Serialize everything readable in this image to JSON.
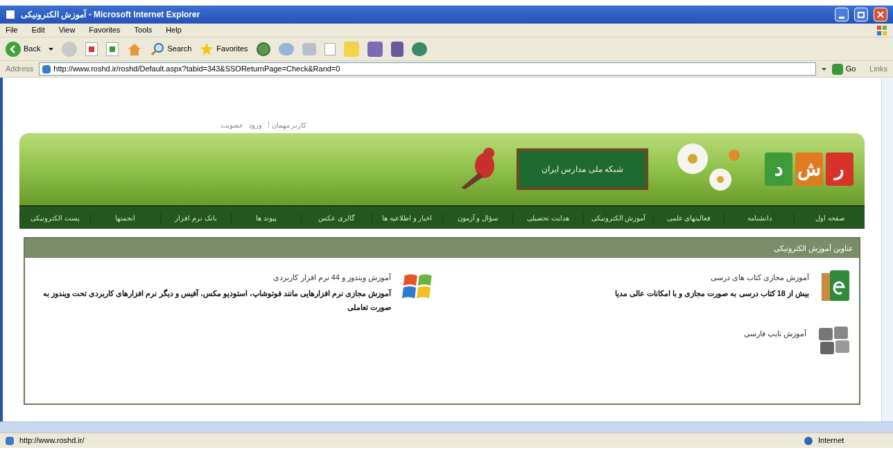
{
  "window": {
    "title": "آموزش الکترونیکی - Microsoft Internet Explorer"
  },
  "menu_bar": {
    "file": "File",
    "edit": "Edit",
    "view": "View",
    "favorites": "Favorites",
    "tools": "Tools",
    "help": "Help"
  },
  "toolbar": {
    "back": "Back",
    "search": "Search",
    "favorites": "Favorites"
  },
  "address": {
    "label": "Address",
    "value": "http://www.roshd.ir/roshd/Default.aspx?tabid=343&SSOReturnPage=Check&Rand=0",
    "go": "Go",
    "links": "Links"
  },
  "site": {
    "user_links": [
      "کاربر مهمان !",
      "ورود",
      "عضویت"
    ],
    "board_text": "شبکه ملی مدارس ایران",
    "logo_letters": [
      "ر",
      "ش",
      "د"
    ],
    "nav": [
      "صفحه اول",
      "دانشنامه",
      "فعالیتهای علمی",
      "آموزش الکترونیکی",
      "هدایت تحصیلی",
      "سؤال و آزمون",
      "اخبار و اطلاعیه ها",
      "گالری عکس",
      "پیوند ها",
      "بانک نرم افزار",
      "انجمنها",
      "پست الکترونیکی"
    ],
    "panel_title": "عناوین آموزش الکترونیکی",
    "items": [
      {
        "kind": "book",
        "title": "آموزش مجازی کتاب های درسی",
        "description": "بیش از 18 کتاب درسی به صورت مجازی و با امکانات عالی مدیا"
      },
      {
        "kind": "windows",
        "title": "آموزش ویندوز و 44 نرم افزار کاربردی",
        "description": "آموزش مجازی نرم افزارهایی مانند فوتوشاپ، استودیو مکس، آفیس و دیگر نرم افزارهای کاربردی تحت ویندوز به صورت تعاملی"
      },
      {
        "kind": "keyboard",
        "title": "آموزش تایپ فارسی"
      }
    ]
  },
  "status_bar": {
    "url": "http://www.roshd.ir/",
    "zone": "Internet"
  }
}
